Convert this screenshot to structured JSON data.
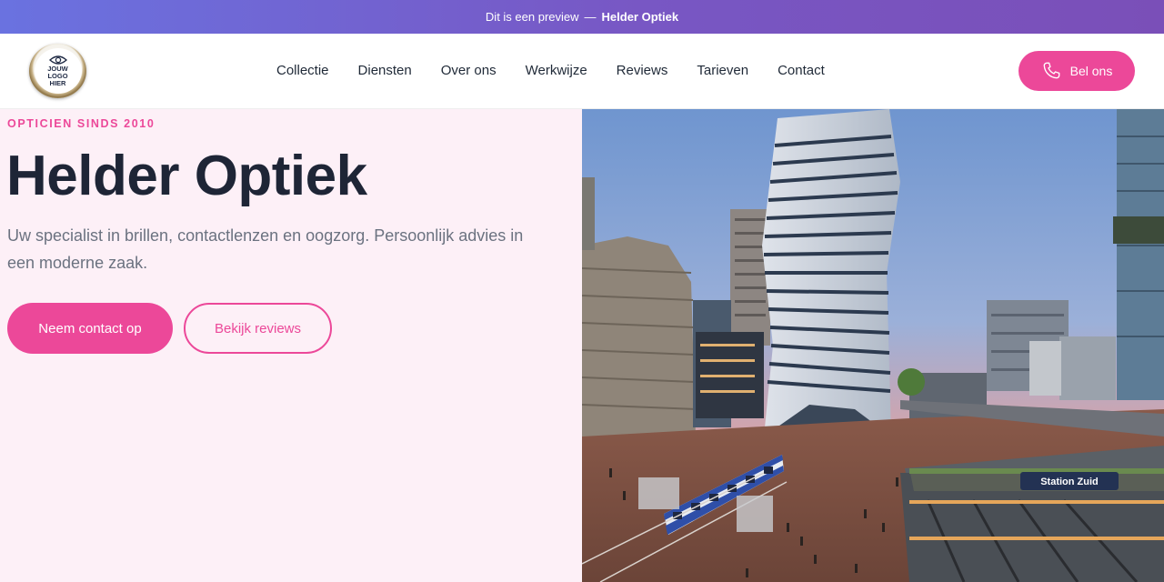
{
  "preview_bar": {
    "text": "Dit is een preview",
    "separator": "—",
    "brand": "Helder Optiek"
  },
  "logo": {
    "line1": "JOUW LOGO",
    "line2": "HIER",
    "icon": "eye-icon"
  },
  "nav": {
    "items": [
      {
        "label": "Collectie"
      },
      {
        "label": "Diensten"
      },
      {
        "label": "Over ons"
      },
      {
        "label": "Werkwijze"
      },
      {
        "label": "Reviews"
      },
      {
        "label": "Tarieven"
      },
      {
        "label": "Contact"
      }
    ]
  },
  "header": {
    "call_label": "Bel ons",
    "call_icon": "phone-icon"
  },
  "hero": {
    "eyebrow": "OPTICIEN SINDS 2010",
    "title": "Helder Optiek",
    "subtitle": "Uw specialist in brillen, contactlenzen en oogzorg. Persoonlijk advies in een moderne zaak.",
    "primary_cta": "Neem contact op",
    "secondary_cta": "Bekijk reviews"
  },
  "image": {
    "sign_text": "Station Zuid"
  },
  "colors": {
    "accent": "#ec4899",
    "hero_bg": "#fdf0f7",
    "title": "#1e2536",
    "gradient_start": "#6a72e0",
    "gradient_end": "#7a4fb8"
  }
}
